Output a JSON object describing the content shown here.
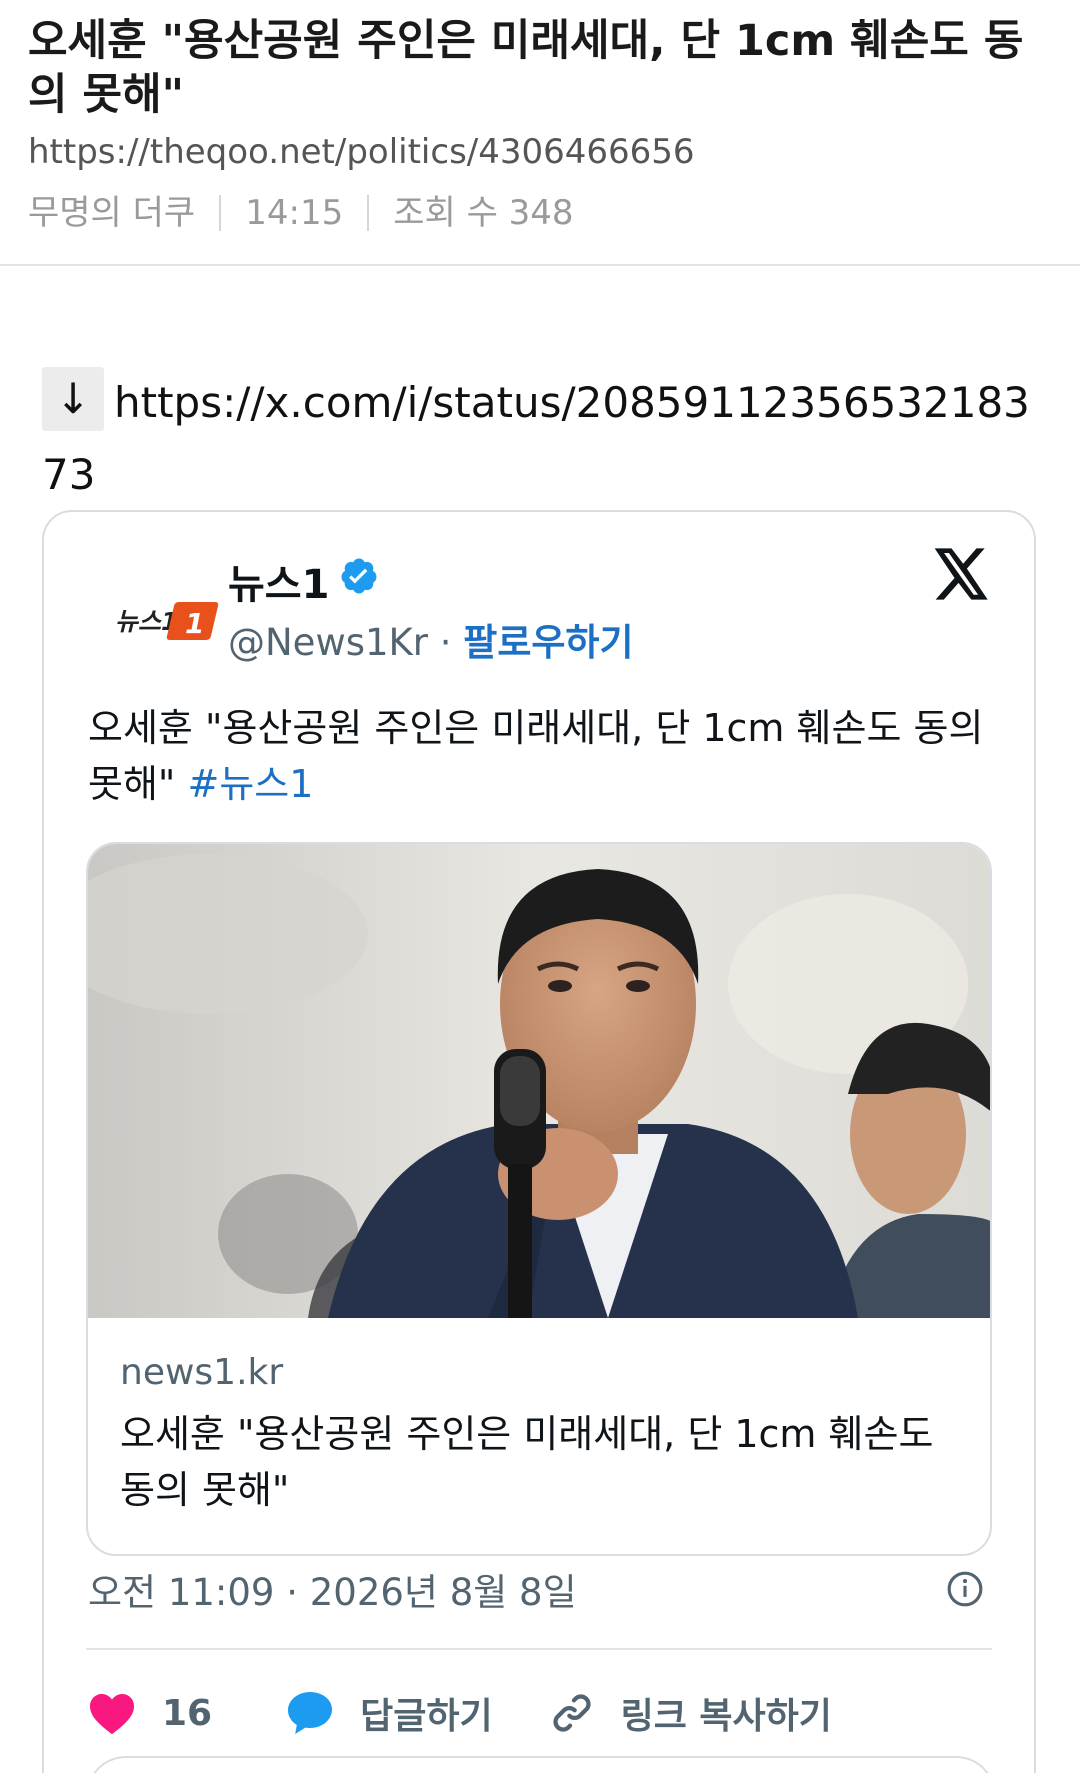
{
  "post": {
    "title": "오세훈 \"용산공원 주인은 미래세대, 단 1cm 훼손도 동의 못해\"",
    "url": "https://theqoo.net/politics/4306466656",
    "author": "무명의 더쿠",
    "time": "14:15",
    "views": "조회 수 348"
  },
  "link": {
    "arrow": "↓",
    "url": "https://x.com/i/status/20859112356532183​73"
  },
  "tweet": {
    "account_name": "뉴스1",
    "handle": "@News1Kr",
    "separator": " · ",
    "follow": "팔로우하기",
    "logo_text": "뉴스1",
    "text": "오세훈 \"용산공원 주인은 미래세대, 단 1cm 훼손도 동의 못해\" ",
    "hashtag": "#뉴스1",
    "preview": {
      "domain": "news1.kr",
      "title": "오세훈 \"용산공원 주인은 미래세대, 단 1cm 훼손도 동의 못해\""
    },
    "date": "오전 11:09 · 2026년 8월 8일",
    "likes": "16",
    "reply": "답글하기",
    "copy_link": "링크 복사하기"
  },
  "colors": {
    "link_blue": "#1d6fc4",
    "verified_blue": "#1d9bf0",
    "heart": "#f91880",
    "logo_orange": "#e8511c"
  },
  "icons": [
    "down-arrow-icon",
    "verified-icon",
    "x-logo-icon",
    "info-icon",
    "heart-icon",
    "reply-bubble-icon",
    "link-icon"
  ]
}
